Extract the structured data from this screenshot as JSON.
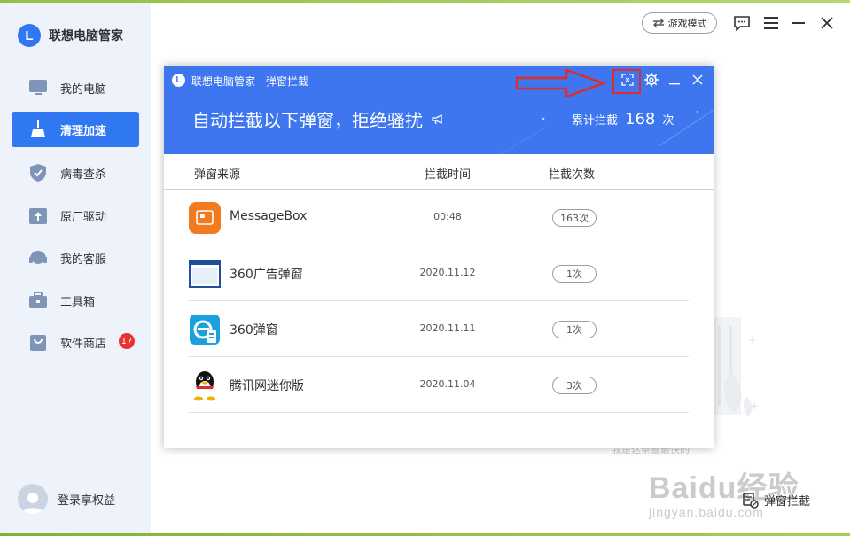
{
  "app": {
    "name": "联想电脑管家"
  },
  "sidebar": {
    "items": [
      {
        "label": "我的电脑",
        "icon": "computer-icon"
      },
      {
        "label": "清理加速",
        "icon": "broom-icon",
        "active": true
      },
      {
        "label": "病毒查杀",
        "icon": "shield-icon"
      },
      {
        "label": "原厂驱动",
        "icon": "driver-icon"
      },
      {
        "label": "我的客服",
        "icon": "headset-icon"
      },
      {
        "label": "工具箱",
        "icon": "toolbox-icon"
      },
      {
        "label": "软件商店",
        "icon": "shopping-bag-icon",
        "badge": "17"
      }
    ],
    "login_label": "登录享权益"
  },
  "topbar": {
    "game_mode_label": "游戏模式"
  },
  "background": {
    "bottom_link_label": "弹窗拦截",
    "faded_text": "我是这条窗最快的"
  },
  "watermark": {
    "main": "Baidu经验",
    "sub": "jingyan.baidu.com"
  },
  "dialog": {
    "title": "联想电脑管家 - 弹窗拦截",
    "headline": "自动拦截以下弹窗，拒绝骚扰",
    "count_label": "累计拦截",
    "count_value": "168",
    "count_unit": "次",
    "columns": {
      "source": "弹窗来源",
      "time": "拦截时间",
      "count": "拦截次数"
    },
    "rows": [
      {
        "name": "MessageBox",
        "time": "00:48",
        "count": "163次",
        "icon": "messagebox-icon"
      },
      {
        "name": "360广告弹窗",
        "time": "2020.11.12",
        "count": "1次",
        "icon": "window-icon"
      },
      {
        "name": "360弹窗",
        "time": "2020.11.11",
        "count": "1次",
        "icon": "browser-e-icon"
      },
      {
        "name": "腾讯网迷你版",
        "time": "2020.11.04",
        "count": "3次",
        "icon": "qq-penguin-icon"
      }
    ]
  },
  "colors": {
    "accent": "#2f78f2",
    "dialog_header": "#3d76ee",
    "annotation_red": "#e32a2a",
    "badge_red": "#e8332f"
  }
}
